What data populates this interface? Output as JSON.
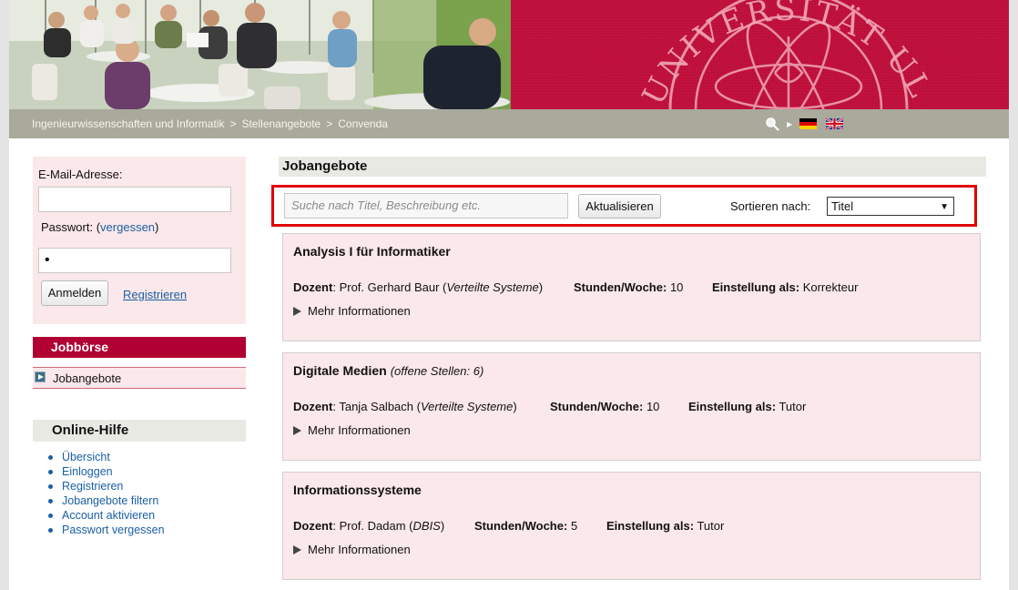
{
  "breadcrumb": {
    "items": [
      "Ingenieurwissenschaften und Informatik",
      "Stellenangebote",
      "Convenda"
    ],
    "separator": ">"
  },
  "banner": {
    "seal_text": "UNIVERSITÄT ULM"
  },
  "language_flags": [
    "german-flag-icon",
    "english-flag-icon"
  ],
  "login": {
    "email_label": "E-Mail-Adresse:",
    "email_value": "",
    "password_label": "Passwort:",
    "forgot_open": "(",
    "forgot_link": "vergessen",
    "forgot_close": ")",
    "password_value": "•",
    "login_button": "Anmelden",
    "register_link": "Registrieren"
  },
  "jobboerse": {
    "heading": "Jobbörse",
    "items": [
      "Jobangebote"
    ]
  },
  "help": {
    "heading": "Online-Hilfe",
    "items": [
      "Übersicht",
      "Einloggen",
      "Registrieren",
      "Jobangebote filtern",
      "Account aktivieren",
      "Passwort vergessen"
    ]
  },
  "main": {
    "heading": "Jobangebote",
    "search_placeholder": "Suche nach Titel, Beschreibung etc.",
    "refresh_button": "Aktualisieren",
    "sort_label": "Sortieren nach:",
    "sort_selected": "Titel"
  },
  "jobs": [
    {
      "title": "Analysis I für Informatiker",
      "subtitle": "",
      "dozent_label": "Dozent",
      "dozent_name": "Prof. Gerhard Baur",
      "dozent_group": "Verteilte Systeme",
      "hours_label": "Stunden/Woche:",
      "hours": "10",
      "role_label": "Einstellung als:",
      "role": "Korrekteur",
      "more": "Mehr Informationen"
    },
    {
      "title": "Digitale Medien",
      "subtitle": "(offene Stellen: 6)",
      "dozent_label": "Dozent",
      "dozent_name": "Tanja Salbach",
      "dozent_group": "Verteilte Systeme",
      "hours_label": "Stunden/Woche:",
      "hours": "10",
      "role_label": "Einstellung als:",
      "role": "Tutor",
      "more": "Mehr Informationen"
    },
    {
      "title": "Informationssysteme",
      "subtitle": "",
      "dozent_label": "Dozent",
      "dozent_name": "Prof. Dadam",
      "dozent_group": "DBIS",
      "hours_label": "Stunden/Woche:",
      "hours": "5",
      "role_label": "Einstellung als:",
      "role": "Tutor",
      "more": "Mehr Informationen"
    }
  ],
  "colors": {
    "brand_red": "#b10032",
    "banner_red": "#c8123f",
    "card_bg": "#fbe8ea",
    "highlight_border": "#e00000",
    "link": "#1a5fa5"
  }
}
